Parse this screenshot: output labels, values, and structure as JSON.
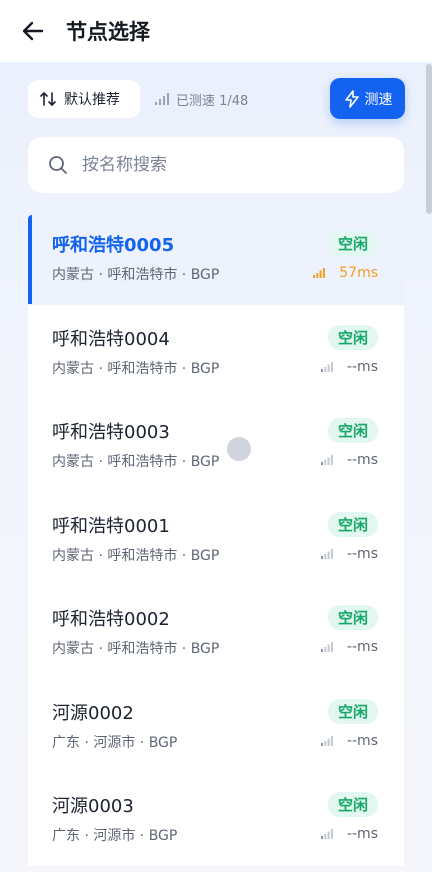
{
  "header": {
    "title": "节点选择",
    "back_icon": "arrow-left-icon"
  },
  "toolbar": {
    "sort_label": "默认推荐",
    "tested_label": "已测速 1/48",
    "speed_test_label": "测速"
  },
  "search": {
    "placeholder": "按名称搜索"
  },
  "colors": {
    "accent": "#1463f0",
    "idle_green": "#17a86a",
    "latency_orange": "#f0a020"
  },
  "nodes": [
    {
      "name": "呼和浩特0005",
      "location": "内蒙古 · 呼和浩特市 · BGP",
      "status": "空闲",
      "latency": "57ms",
      "selected": true
    },
    {
      "name": "呼和浩特0004",
      "location": "内蒙古 · 呼和浩特市 · BGP",
      "status": "空闲",
      "latency": "--ms"
    },
    {
      "name": "呼和浩特0003",
      "location": "内蒙古 · 呼和浩特市 · BGP",
      "status": "空闲",
      "latency": "--ms"
    },
    {
      "name": "呼和浩特0001",
      "location": "内蒙古 · 呼和浩特市 · BGP",
      "status": "空闲",
      "latency": "--ms"
    },
    {
      "name": "呼和浩特0002",
      "location": "内蒙古 · 呼和浩特市 · BGP",
      "status": "空闲",
      "latency": "--ms"
    },
    {
      "name": "河源0002",
      "location": "广东 · 河源市 · BGP",
      "status": "空闲",
      "latency": "--ms"
    },
    {
      "name": "河源0003",
      "location": "广东 · 河源市 · BGP",
      "status": "空闲",
      "latency": "--ms"
    }
  ]
}
